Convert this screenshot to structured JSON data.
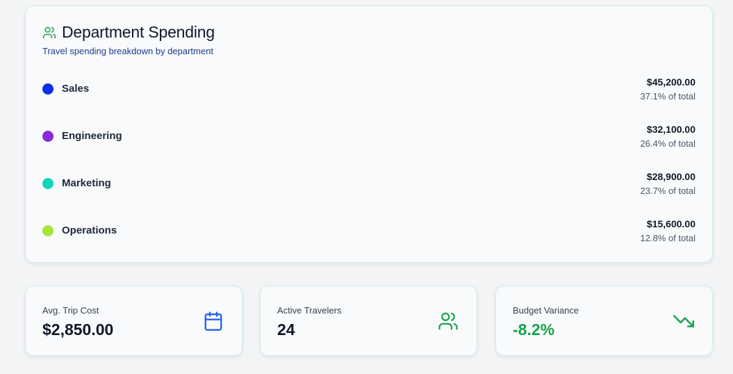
{
  "department_spending": {
    "title": "Department Spending",
    "subtitle": "Travel spending breakdown by department",
    "icon": "users-icon",
    "departments": [
      {
        "name": "Sales",
        "amount": "$45,200.00",
        "percent": "37.1% of total",
        "color": "#0a31e8"
      },
      {
        "name": "Engineering",
        "amount": "$32,100.00",
        "percent": "26.4% of total",
        "color": "#8a2ad6"
      },
      {
        "name": "Marketing",
        "amount": "$28,900.00",
        "percent": "23.7% of total",
        "color": "#12d6b8"
      },
      {
        "name": "Operations",
        "amount": "$15,600.00",
        "percent": "12.8% of total",
        "color": "#a3e635"
      }
    ]
  },
  "stats": [
    {
      "label": "Avg. Trip Cost",
      "value": "$2,850.00",
      "icon": "calendar-icon",
      "icon_color": "#2563eb"
    },
    {
      "label": "Active Travelers",
      "value": "24",
      "icon": "users-icon",
      "icon_color": "#16a34a"
    },
    {
      "label": "Budget Variance",
      "value": "-8.2%",
      "icon": "trending-down-icon",
      "icon_color": "#16a34a",
      "value_color": "#16a34a"
    }
  ]
}
